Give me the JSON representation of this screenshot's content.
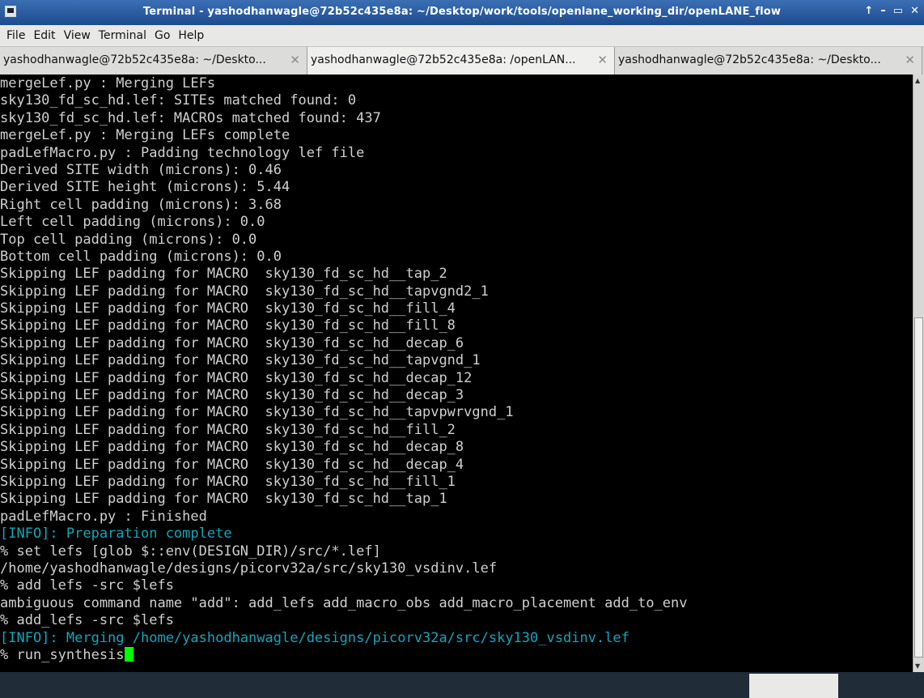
{
  "window": {
    "title": "Terminal - yashodhanwagle@72b52c435e8a: ~/Desktop/work/tools/openlane_working_dir/openLANE_flow",
    "controls": [
      "↑",
      "–",
      "▭",
      "✕"
    ]
  },
  "menu": [
    "File",
    "Edit",
    "View",
    "Terminal",
    "Go",
    "Help"
  ],
  "tabs": [
    {
      "label": "yashodhanwagle@72b52c435e8a: ~/Deskto...",
      "close": "✕"
    },
    {
      "label": "yashodhanwagle@72b52c435e8a: /openLAN...",
      "close": "✕"
    },
    {
      "label": "yashodhanwagle@72b52c435e8a: ~/Deskto...",
      "close": "✕"
    }
  ],
  "terminal": {
    "lines": [
      {
        "text": "mergeLef.py : Merging LEFs",
        "type": "normal"
      },
      {
        "text": "sky130_fd_sc_hd.lef: SITEs matched found: 0",
        "type": "normal"
      },
      {
        "text": "sky130_fd_sc_hd.lef: MACROs matched found: 437",
        "type": "normal"
      },
      {
        "text": "mergeLef.py : Merging LEFs complete",
        "type": "normal"
      },
      {
        "text": "padLefMacro.py : Padding technology lef file",
        "type": "normal"
      },
      {
        "text": "Derived SITE width (microns): 0.46",
        "type": "normal"
      },
      {
        "text": "Derived SITE height (microns): 5.44",
        "type": "normal"
      },
      {
        "text": "Right cell padding (microns): 3.68",
        "type": "normal"
      },
      {
        "text": "Left cell padding (microns): 0.0",
        "type": "normal"
      },
      {
        "text": "Top cell padding (microns): 0.0",
        "type": "normal"
      },
      {
        "text": "Bottom cell padding (microns): 0.0",
        "type": "normal"
      },
      {
        "text": "Skipping LEF padding for MACRO  sky130_fd_sc_hd__tap_2",
        "type": "normal"
      },
      {
        "text": "Skipping LEF padding for MACRO  sky130_fd_sc_hd__tapvgnd2_1",
        "type": "normal"
      },
      {
        "text": "Skipping LEF padding for MACRO  sky130_fd_sc_hd__fill_4",
        "type": "normal"
      },
      {
        "text": "Skipping LEF padding for MACRO  sky130_fd_sc_hd__fill_8",
        "type": "normal"
      },
      {
        "text": "Skipping LEF padding for MACRO  sky130_fd_sc_hd__decap_6",
        "type": "normal"
      },
      {
        "text": "Skipping LEF padding for MACRO  sky130_fd_sc_hd__tapvgnd_1",
        "type": "normal"
      },
      {
        "text": "Skipping LEF padding for MACRO  sky130_fd_sc_hd__decap_12",
        "type": "normal"
      },
      {
        "text": "Skipping LEF padding for MACRO  sky130_fd_sc_hd__decap_3",
        "type": "normal"
      },
      {
        "text": "Skipping LEF padding for MACRO  sky130_fd_sc_hd__tapvpwrvgnd_1",
        "type": "normal"
      },
      {
        "text": "Skipping LEF padding for MACRO  sky130_fd_sc_hd__fill_2",
        "type": "normal"
      },
      {
        "text": "Skipping LEF padding for MACRO  sky130_fd_sc_hd__decap_8",
        "type": "normal"
      },
      {
        "text": "Skipping LEF padding for MACRO  sky130_fd_sc_hd__decap_4",
        "type": "normal"
      },
      {
        "text": "Skipping LEF padding for MACRO  sky130_fd_sc_hd__fill_1",
        "type": "normal"
      },
      {
        "text": "Skipping LEF padding for MACRO  sky130_fd_sc_hd__tap_1",
        "type": "normal"
      },
      {
        "text": "padLefMacro.py : Finished",
        "type": "normal"
      },
      {
        "text": "[INFO]: Preparation complete",
        "type": "info"
      },
      {
        "text": "% set lefs [glob $::env(DESIGN_DIR)/src/*.lef]",
        "type": "normal"
      },
      {
        "text": "/home/yashodhanwagle/designs/picorv32a/src/sky130_vsdinv.lef",
        "type": "normal"
      },
      {
        "text": "% add lefs -src $lefs",
        "type": "normal"
      },
      {
        "text": "ambiguous command name \"add\": add_lefs add_macro_obs add_macro_placement add_to_env",
        "type": "normal"
      },
      {
        "text": "% add_lefs -src $lefs",
        "type": "normal"
      },
      {
        "text": "[INFO]: Merging /home/yashodhanwagle/designs/picorv32a/src/sky130_vsdinv.lef",
        "type": "info"
      },
      {
        "text": "% run_synthesis",
        "type": "prompt"
      }
    ],
    "cursor_color": "#00ff00",
    "info_color": "#13a6b8",
    "text_color": "#cfcfcf",
    "background": "#000000"
  }
}
